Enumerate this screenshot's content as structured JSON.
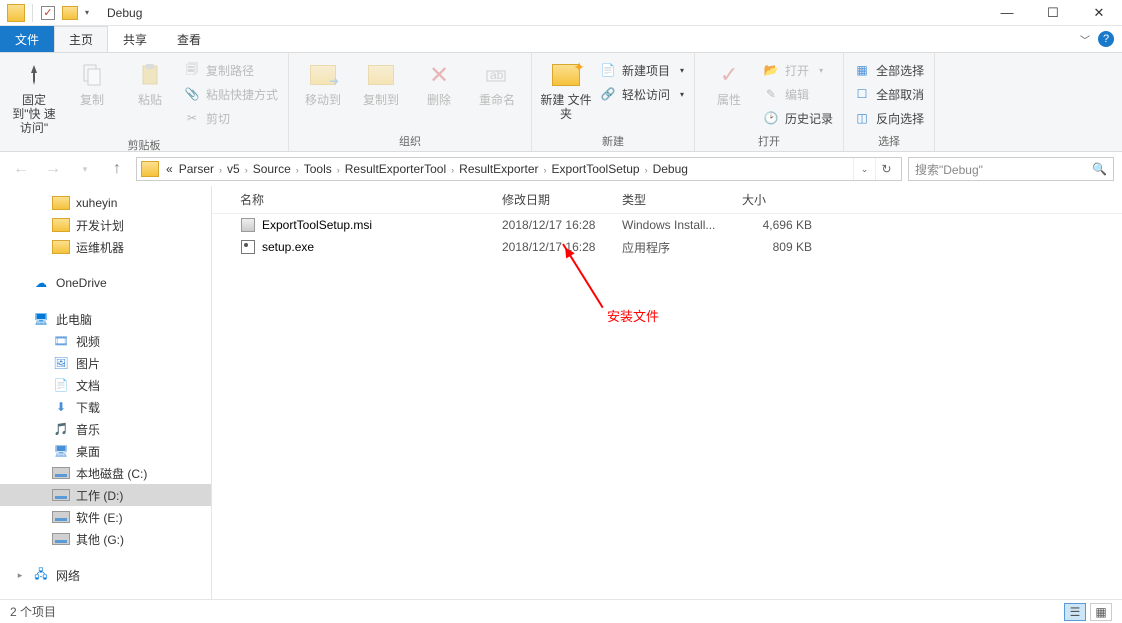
{
  "window": {
    "title": "Debug"
  },
  "tabs": {
    "file": "文件",
    "home": "主页",
    "share": "共享",
    "view": "查看"
  },
  "ribbon": {
    "pin": "固定到\"快\n速访问\"",
    "copy": "复制",
    "paste": "粘贴",
    "copypath": "复制路径",
    "pastesc": "粘贴快捷方式",
    "cut": "剪切",
    "g_clip": "剪贴板",
    "moveto": "移动到",
    "copyto": "复制到",
    "delete": "删除",
    "rename": "重命名",
    "g_org": "组织",
    "newfolder": "新建\n文件夹",
    "newitem": "新建项目",
    "easyaccess": "轻松访问",
    "g_new": "新建",
    "props": "属性",
    "open": "打开",
    "edit": "编辑",
    "history": "历史记录",
    "g_open": "打开",
    "selall": "全部选择",
    "selnone": "全部取消",
    "selinv": "反向选择",
    "g_sel": "选择"
  },
  "breadcrumbs": [
    "Parser",
    "v5",
    "Source",
    "Tools",
    "ResultExporterTool",
    "ResultExporter",
    "ExportToolSetup",
    "Debug"
  ],
  "breadcrumb_prefix": "«",
  "search_placeholder": "搜索\"Debug\"",
  "nav": {
    "quick": [
      {
        "label": "xuheyin"
      },
      {
        "label": "开发计划"
      },
      {
        "label": "运维机器"
      }
    ],
    "onedrive": "OneDrive",
    "thispc": "此电脑",
    "pcitems": [
      {
        "label": "视频"
      },
      {
        "label": "图片"
      },
      {
        "label": "文档"
      },
      {
        "label": "下载"
      },
      {
        "label": "音乐"
      },
      {
        "label": "桌面"
      },
      {
        "label": "本地磁盘 (C:)",
        "drive": true
      },
      {
        "label": "工作 (D:)",
        "drive": true,
        "sel": true
      },
      {
        "label": "软件 (E:)",
        "drive": true
      },
      {
        "label": "其他 (G:)",
        "drive": true
      }
    ],
    "network": "网络"
  },
  "columns": {
    "name": "名称",
    "date": "修改日期",
    "type": "类型",
    "size": "大小"
  },
  "files": [
    {
      "icon": "msi",
      "name": "ExportToolSetup.msi",
      "date": "2018/12/17 16:28",
      "type": "Windows Install...",
      "size": "4,696 KB"
    },
    {
      "icon": "exe",
      "name": "setup.exe",
      "date": "2018/12/17 16:28",
      "type": "应用程序",
      "size": "809 KB"
    }
  ],
  "annotation": "安装文件",
  "status": "2 个项目"
}
